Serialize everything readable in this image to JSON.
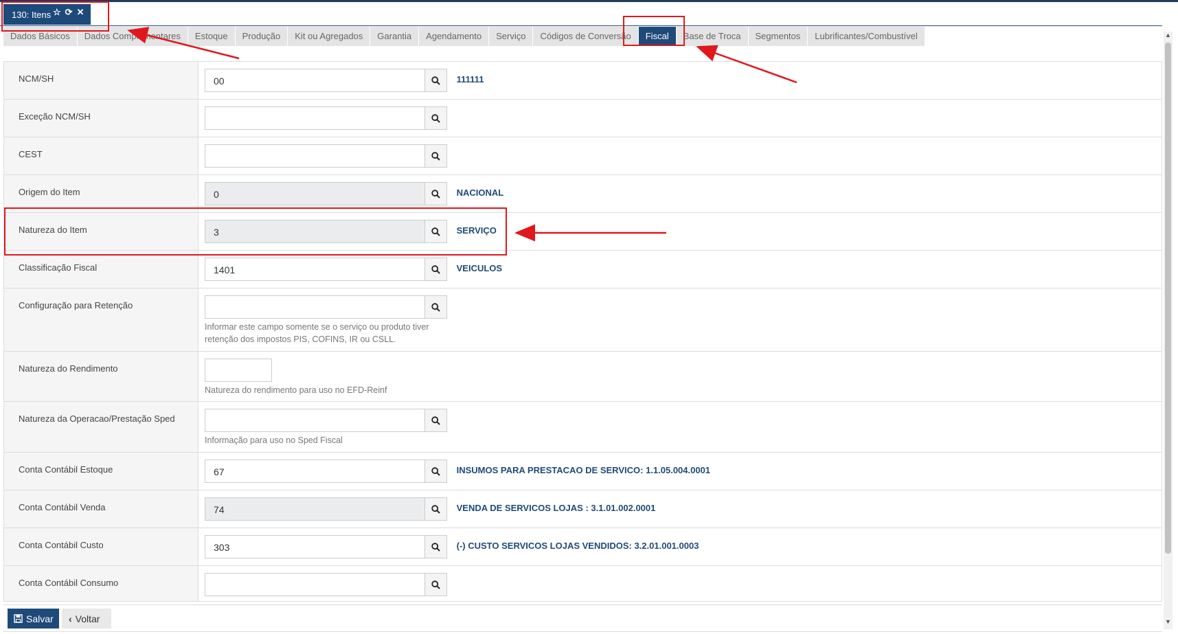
{
  "window_tab": {
    "title": "130: Itens"
  },
  "tabs": [
    {
      "label": "Dados Básicos",
      "active": false
    },
    {
      "label": "Dados Complementares",
      "active": false
    },
    {
      "label": "Estoque",
      "active": false
    },
    {
      "label": "Produção",
      "active": false
    },
    {
      "label": "Kit ou Agregados",
      "active": false
    },
    {
      "label": "Garantia",
      "active": false
    },
    {
      "label": "Agendamento",
      "active": false
    },
    {
      "label": "Serviço",
      "active": false
    },
    {
      "label": "Códigos de Conversão",
      "active": false
    },
    {
      "label": "Fiscal",
      "active": true
    },
    {
      "label": "Base de Troca",
      "active": false
    },
    {
      "label": "Segmentos",
      "active": false
    },
    {
      "label": "Lubrificantes/Combustível",
      "active": false
    }
  ],
  "fields": {
    "ncm": {
      "label": "NCM/SH",
      "value": "00",
      "desc": "111111"
    },
    "excecao_ncm": {
      "label": "Exceção NCM/SH",
      "value": ""
    },
    "cest": {
      "label": "CEST",
      "value": ""
    },
    "origem": {
      "label": "Origem do Item",
      "value": "0",
      "desc": "NACIONAL"
    },
    "natureza_item": {
      "label": "Natureza do Item",
      "value": "3",
      "desc": "SERVIÇO"
    },
    "classificacao_fiscal": {
      "label": "Classificação Fiscal",
      "value": "1401",
      "desc": "VEICULOS"
    },
    "config_retencao": {
      "label": "Configuração para Retenção",
      "value": "",
      "help_1": "Informar este campo somente se o serviço ou produto tiver",
      "help_2": "retenção dos impostos PIS, COFINS, IR ou CSLL."
    },
    "natureza_rendimento": {
      "label": "Natureza do Rendimento",
      "value": "",
      "help": "Natureza do rendimento para uso no EFD-Reinf"
    },
    "natureza_operacao": {
      "label": "Natureza da Operacao/Prestação Sped",
      "value": "",
      "help": "Informação para uso no Sped Fiscal"
    },
    "conta_estoque": {
      "label": "Conta Contábil Estoque",
      "value": "67",
      "desc": "INSUMOS PARA PRESTACAO DE SERVICO: 1.1.05.004.0001"
    },
    "conta_venda": {
      "label": "Conta Contábil Venda",
      "value": "74",
      "desc": "VENDA DE SERVICOS LOJAS : 3.1.01.002.0001"
    },
    "conta_custo": {
      "label": "Conta Contábil Custo",
      "value": "303",
      "desc": "(-) CUSTO SERVICOS LOJAS VENDIDOS: 3.2.01.001.0003"
    },
    "conta_consumo": {
      "label": "Conta Contábil Consumo",
      "value": ""
    }
  },
  "buttons": {
    "save": "Salvar",
    "back": "Voltar"
  },
  "icons": {
    "search": "search-icon",
    "star": "star-icon",
    "refresh": "refresh-icon",
    "close": "close-icon",
    "save": "floppy-icon",
    "back": "chevron-left-icon"
  },
  "colors": {
    "primary": "#1e4a7a",
    "annotation": "#e0181e",
    "readonly_bg": "#eaecee"
  }
}
